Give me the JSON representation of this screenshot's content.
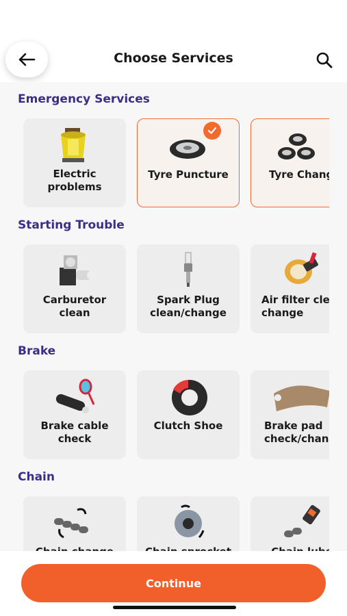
{
  "header": {
    "title": "Choose Services",
    "back_icon": "arrow-left-icon",
    "search_icon": "search-icon"
  },
  "colors": {
    "accent": "#f1602a",
    "section_title": "#3a2f86",
    "card_bg": "#ededed"
  },
  "sections": [
    {
      "title": "Emergency Services",
      "items": [
        {
          "label": "Electric\nproblems",
          "icon": "electric-icon",
          "selected": false
        },
        {
          "label": "Tyre Puncture",
          "icon": "tyre-icon",
          "selected": true
        },
        {
          "label": "Tyre Chang",
          "icon": "tyres-icon",
          "selected": true
        }
      ]
    },
    {
      "title": "Starting Trouble",
      "items": [
        {
          "label": "Carburetor\nclean",
          "icon": "carburetor-icon",
          "selected": false
        },
        {
          "label": "Spark Plug\nclean/change",
          "icon": "spark-plug-icon",
          "selected": false
        },
        {
          "label": "Air filter clea\nchange",
          "icon": "air-filter-icon",
          "selected": false
        }
      ]
    },
    {
      "title": "Brake",
      "items": [
        {
          "label": "Brake cable\ncheck",
          "icon": "brake-cable-icon",
          "selected": false
        },
        {
          "label": "Clutch Shoe",
          "icon": "clutch-shoe-icon",
          "selected": false
        },
        {
          "label": "Brake pad\ncheck/chang",
          "icon": "brake-pad-icon",
          "selected": false
        }
      ]
    },
    {
      "title": "Chain",
      "items": [
        {
          "label": "Chain change",
          "icon": "chain-icon",
          "selected": false
        },
        {
          "label": "Chain sprocket",
          "icon": "sprocket-icon",
          "selected": false
        },
        {
          "label": "Chain lube",
          "icon": "chain-lube-icon",
          "selected": false
        }
      ]
    }
  ],
  "continue_label": "Continue"
}
